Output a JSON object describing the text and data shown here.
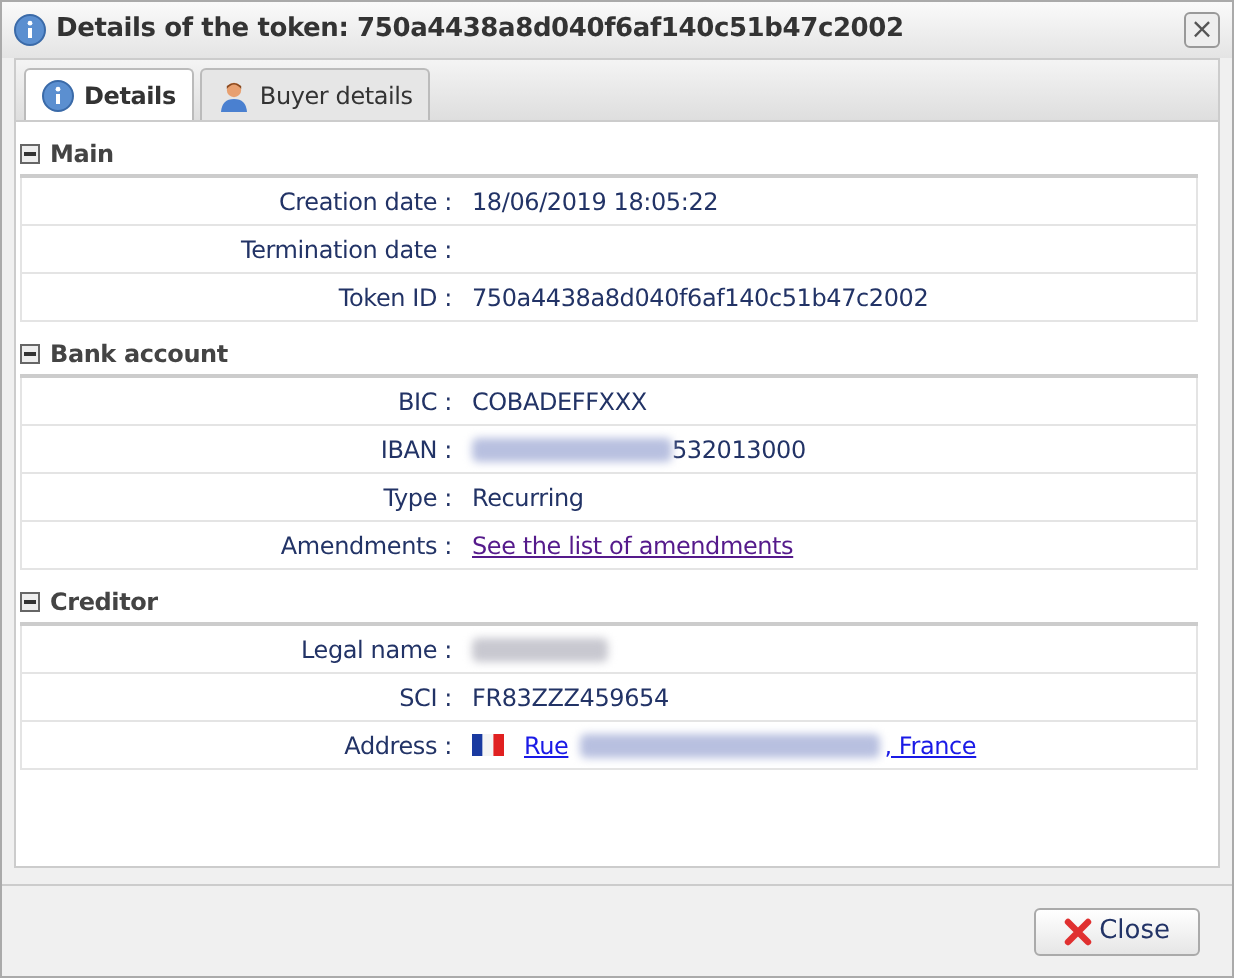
{
  "window": {
    "title": "Details of the token: 750a4438a8d040f6af140c51b47c2002",
    "close": "×"
  },
  "tabs": [
    {
      "label": "Details",
      "selected": true,
      "kind": "info"
    },
    {
      "label": "Buyer details",
      "selected": false,
      "kind": "person"
    }
  ],
  "sections": [
    {
      "title": "Main",
      "expanded": true,
      "rows": [
        {
          "label": "Creation date :",
          "kind": "text",
          "value": "18/06/2019 18:05:22"
        },
        {
          "label": "Termination date :",
          "kind": "empty"
        },
        {
          "label": "Token ID :",
          "kind": "text",
          "value": "750a4438a8d040f6af140c51b47c2002"
        }
      ]
    },
    {
      "title": "Bank account",
      "expanded": true,
      "rows": [
        {
          "label": "BIC :",
          "kind": "text",
          "value": "COBADEFFXXX"
        },
        {
          "label": "IBAN :",
          "kind": "masked",
          "value": "532013000"
        },
        {
          "label": "Type :",
          "kind": "text",
          "value": "Recurring"
        },
        {
          "label": "Amendments :",
          "kind": "link",
          "value": "See the list of amendments"
        }
      ]
    },
    {
      "title": "Creditor",
      "expanded": true,
      "rows": [
        {
          "label": "Legal name :",
          "kind": "hidden"
        },
        {
          "label": "SCI :",
          "kind": "text",
          "value": "FR83ZZZ459654"
        },
        {
          "label": "Address :",
          "kind": "address",
          "prefix": "Rue",
          "suffix": ", France"
        }
      ]
    }
  ],
  "buttons": [
    {
      "label": "Close"
    }
  ]
}
